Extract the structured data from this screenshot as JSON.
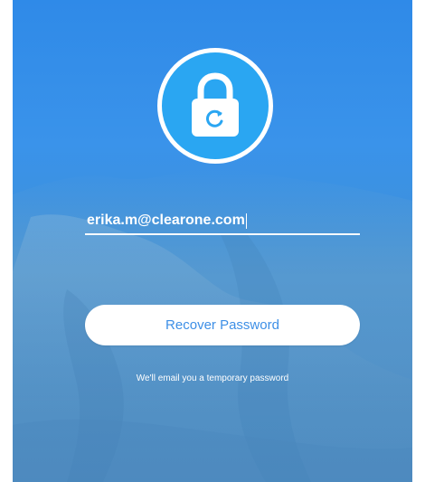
{
  "screen": {
    "icon": "lock-refresh-icon",
    "email": {
      "value": "erika.m@clearone.com"
    },
    "recover_button_label": "Recover Password",
    "hint_text": "We'll email you a temporary password"
  },
  "colors": {
    "background_top": "#2f8ae8",
    "background_bottom": "#4a88c0",
    "lock_circle": "#2aa6f2",
    "button_text": "#3d8fe6",
    "button_bg": "#ffffff"
  }
}
